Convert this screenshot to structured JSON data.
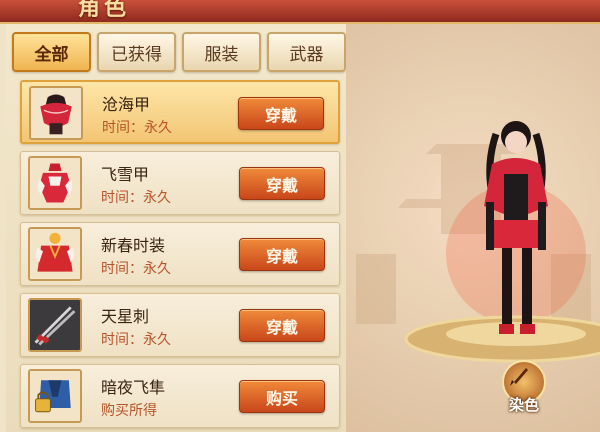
{
  "header": {
    "title": "角色"
  },
  "tabs": [
    {
      "label": "全部",
      "active": true
    },
    {
      "label": "已获得",
      "active": false
    },
    {
      "label": "服装",
      "active": false
    },
    {
      "label": "武器",
      "active": false
    }
  ],
  "items": [
    {
      "name": "沧海甲",
      "time": "时间：永久",
      "action": "穿戴",
      "selected": true,
      "icon": "red-cape-armor-icon"
    },
    {
      "name": "飞雪甲",
      "time": "时间：永久",
      "action": "穿戴",
      "selected": false,
      "icon": "white-red-dress-icon"
    },
    {
      "name": "新春时装",
      "time": "时间：永久",
      "action": "穿戴",
      "selected": false,
      "icon": "red-festive-outfit-icon"
    },
    {
      "name": "天星刺",
      "time": "时间：永久",
      "action": "穿戴",
      "selected": false,
      "icon": "twin-blades-icon"
    },
    {
      "name": "暗夜飞隼",
      "time": "购买所得",
      "action": "购买",
      "selected": false,
      "icon": "locked-blue-armor-icon"
    }
  ],
  "preview": {
    "dye_label": "染色",
    "dye_icon": "brush-icon"
  },
  "colors": {
    "accent": "#e0a33c",
    "button": "#c9461a",
    "banner": "#a8321f",
    "time_text": "#b8542a"
  }
}
